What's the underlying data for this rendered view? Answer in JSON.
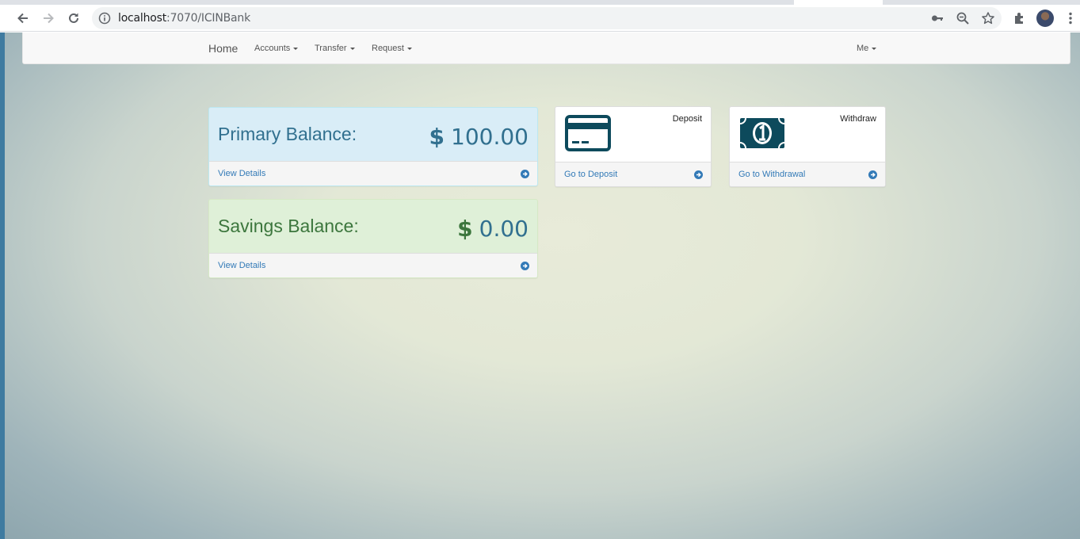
{
  "browser": {
    "url_host": "localhost",
    "url_path": ":7070/ICINBank",
    "icons": [
      "back-icon",
      "forward-icon",
      "reload-icon",
      "info-icon",
      "key-icon",
      "zoom-out-icon",
      "star-icon",
      "extensions-icon",
      "avatar",
      "menu-icon"
    ]
  },
  "navbar": {
    "brand": "Home",
    "menus": [
      "Accounts",
      "Transfer",
      "Request"
    ],
    "right_menu": "Me"
  },
  "primary": {
    "label": "Primary Balance:",
    "currency": "$",
    "amount": "100.00",
    "link": "View Details"
  },
  "savings": {
    "label": "Savings Balance:",
    "currency": "$",
    "amount": "0.00",
    "link": "View Details"
  },
  "deposit": {
    "title": "Deposit",
    "link": "Go to Deposit",
    "icon": "credit-card-icon"
  },
  "withdraw": {
    "title": "Withdraw",
    "link": "Go to Withdrawal",
    "icon": "money-bill-icon"
  },
  "colors": {
    "primary_text": "#31708f",
    "primary_bg": "#d9edf7",
    "savings_text": "#3c763d",
    "savings_bg": "#dff0d8",
    "icon_dark": "#0d4a5c",
    "link": "#337ab7"
  }
}
